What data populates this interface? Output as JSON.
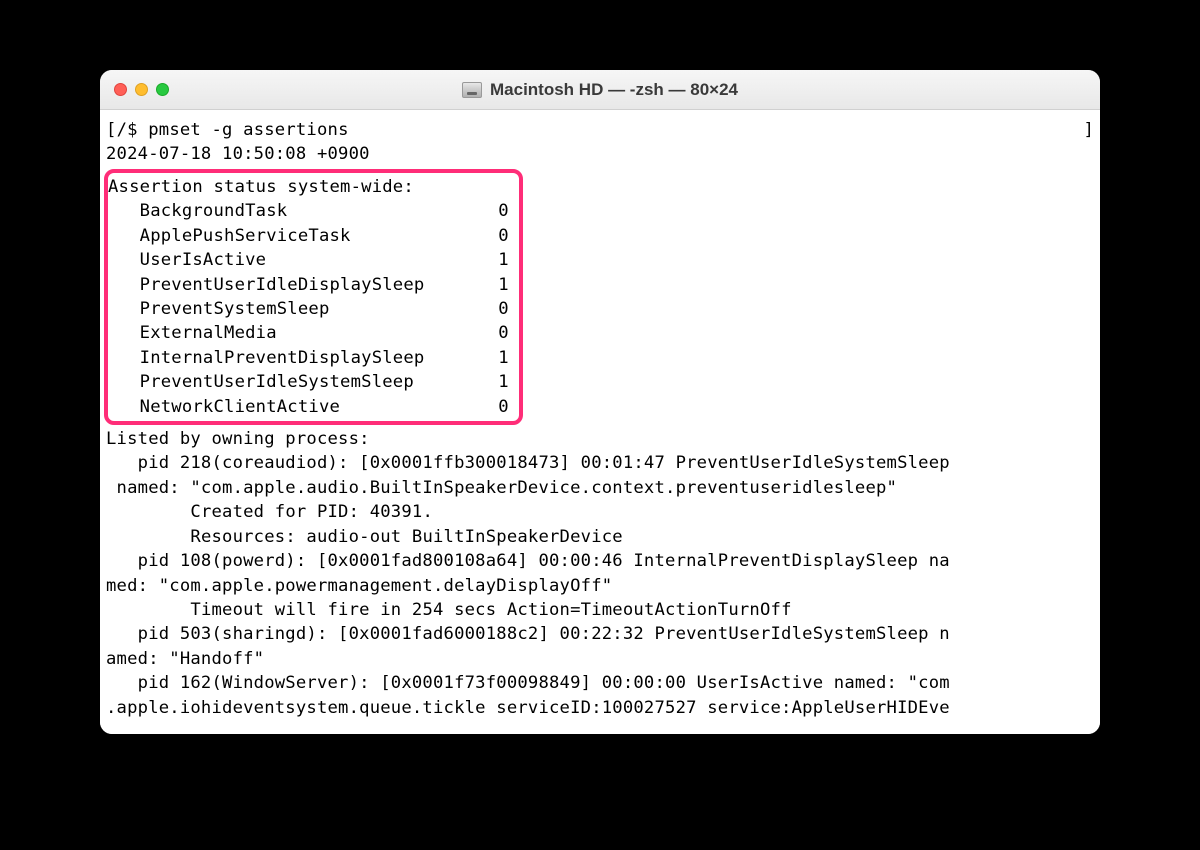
{
  "window": {
    "title": "Macintosh HD — -zsh — 80×24"
  },
  "prompt": {
    "left_bracket": "[",
    "path": "/$ ",
    "command": "pmset -g assertions",
    "right_bracket": "]"
  },
  "timestamp": "2024-07-18 10:50:08 +0900",
  "assert_header": "Assertion status system-wide:",
  "assertions": [
    {
      "name": "BackgroundTask",
      "value": "0"
    },
    {
      "name": "ApplePushServiceTask",
      "value": "0"
    },
    {
      "name": "UserIsActive",
      "value": "1"
    },
    {
      "name": "PreventUserIdleDisplaySleep",
      "value": "1"
    },
    {
      "name": "PreventSystemSleep",
      "value": "0"
    },
    {
      "name": "ExternalMedia",
      "value": "0"
    },
    {
      "name": "InternalPreventDisplaySleep",
      "value": "1"
    },
    {
      "name": "PreventUserIdleSystemSleep",
      "value": "1"
    },
    {
      "name": "NetworkClientActive",
      "value": "0"
    }
  ],
  "listed_header": "Listed by owning process:",
  "body": {
    "l1": "   pid 218(coreaudiod): [0x0001ffb300018473] 00:01:47 PreventUserIdleSystemSleep",
    "l2": " named: \"com.apple.audio.BuiltInSpeakerDevice.context.preventuseridlesleep\"",
    "l3": "\tCreated for PID: 40391. ",
    "l4": "\tResources: audio-out BuiltInSpeakerDevice ",
    "l5": "   pid 108(powerd): [0x0001fad800108a64] 00:00:46 InternalPreventDisplaySleep na",
    "l6": "med: \"com.apple.powermanagement.delayDisplayOff\" ",
    "l7": "\tTimeout will fire in 254 secs Action=TimeoutActionTurnOff",
    "l8": "   pid 503(sharingd): [0x0001fad6000188c2] 00:22:32 PreventUserIdleSystemSleep n",
    "l9": "amed: \"Handoff\" ",
    "l10": "   pid 162(WindowServer): [0x0001f73f00098849] 00:00:00 UserIsActive named: \"com",
    "l11": ".apple.iohideventsystem.queue.tickle serviceID:100027527 service:AppleUserHIDEve"
  }
}
